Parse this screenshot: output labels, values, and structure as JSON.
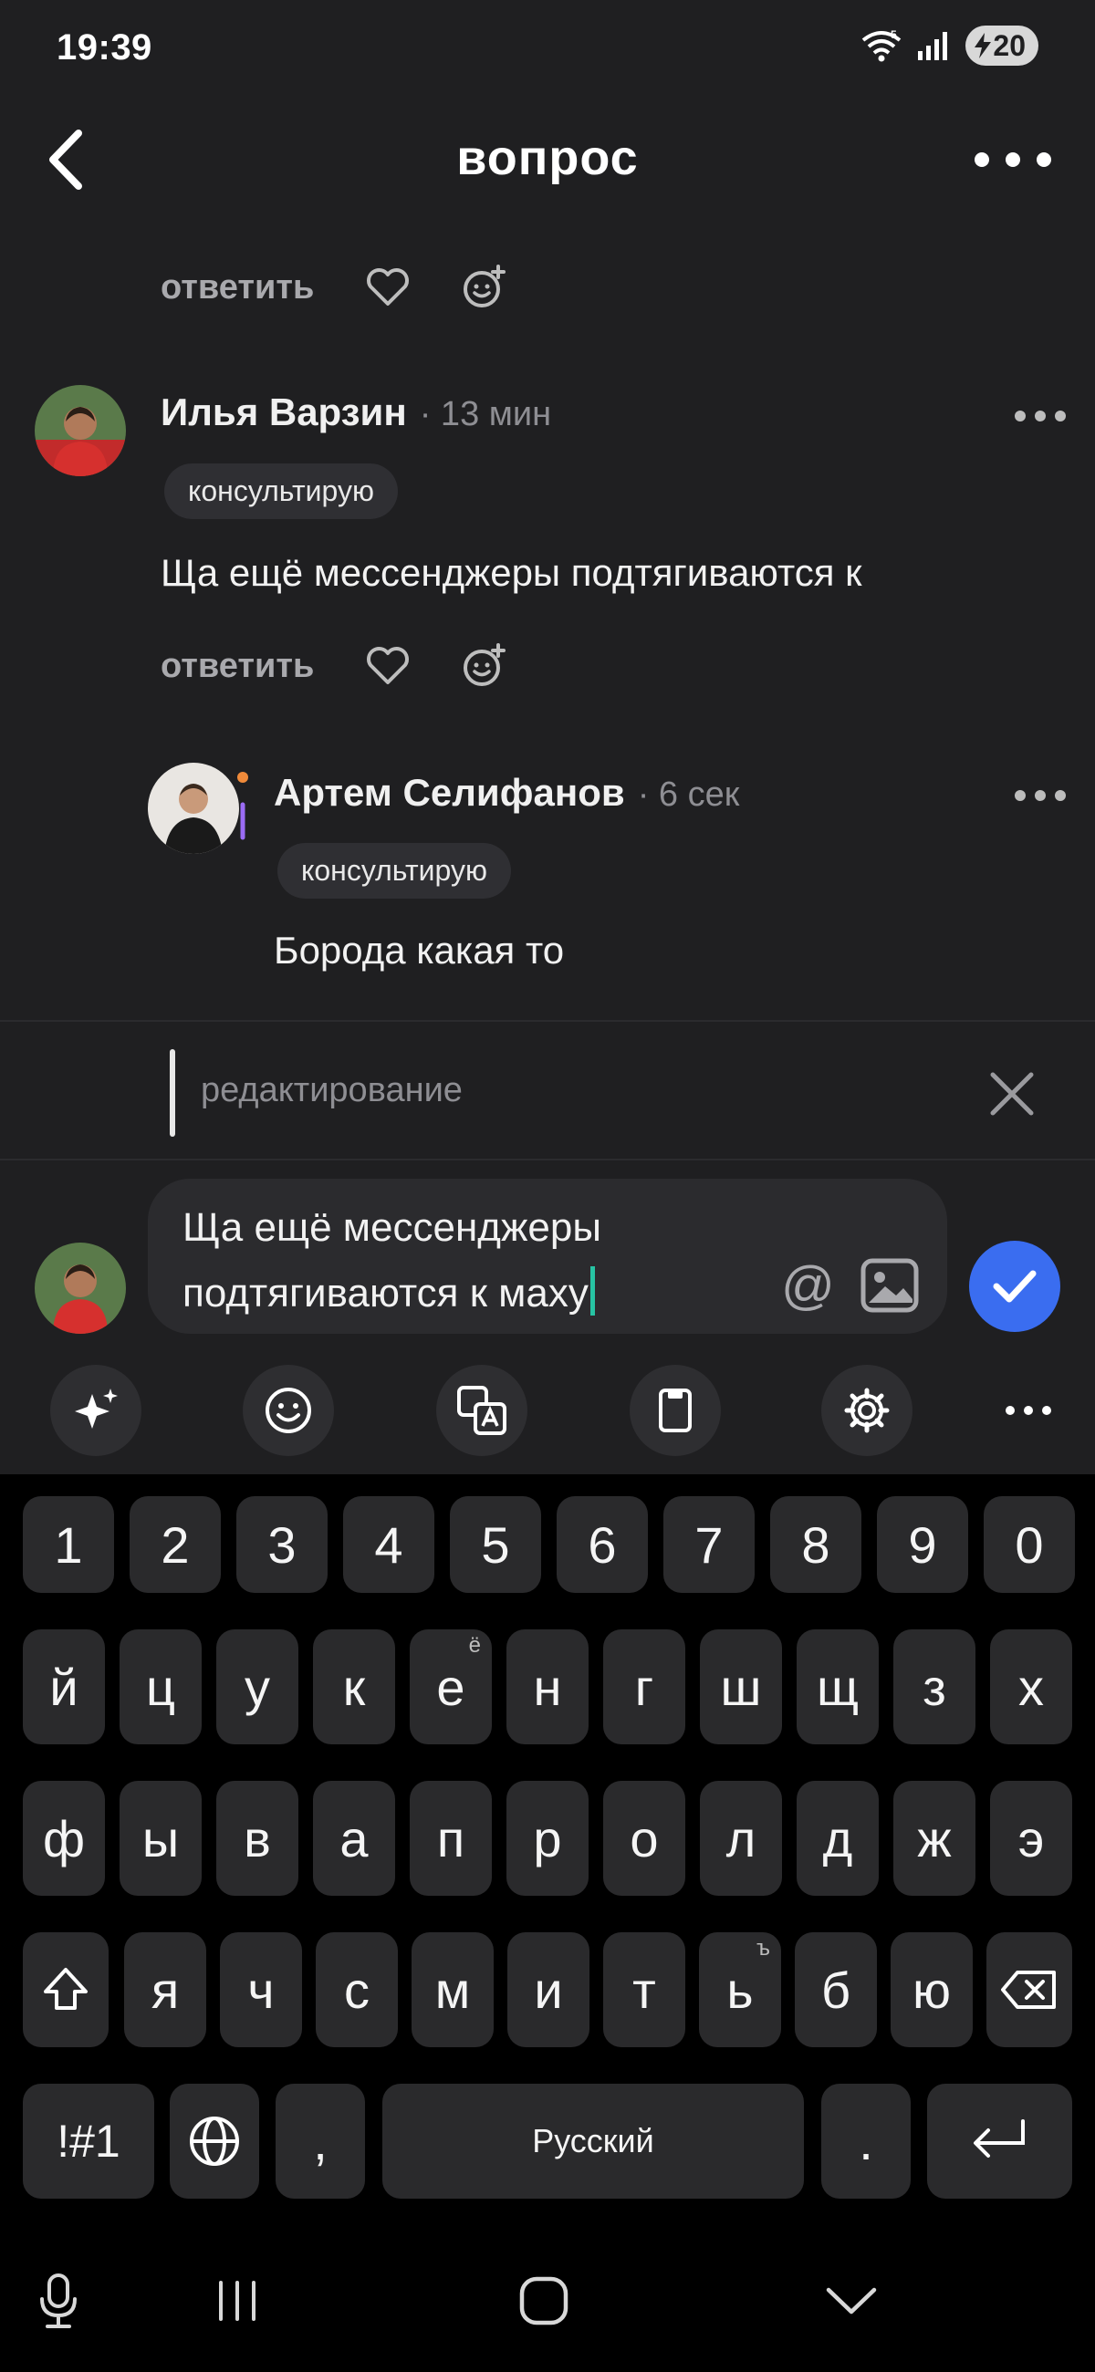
{
  "status_bar": {
    "time": "19:39",
    "battery": "20",
    "network": "5"
  },
  "header": {
    "title": "вопрос"
  },
  "comments": [
    {
      "reply_label": "ответить"
    },
    {
      "username": "Илья Варзин",
      "time": "· 13 мин",
      "badge": "консультирую",
      "text": "Ща ещё мессенджеры подтягиваются к",
      "reply_label": "ответить"
    },
    {
      "username": "Артем Селифанов",
      "time": "· 6 сек",
      "badge": "консультирую",
      "text": "Борода какая то"
    }
  ],
  "edit": {
    "label": "редактирование"
  },
  "input": {
    "value": "Ща ещё мессенджеры подтягиваются к маху",
    "at_symbol": "@"
  },
  "keyboard": {
    "row_numbers": [
      "1",
      "2",
      "3",
      "4",
      "5",
      "6",
      "7",
      "8",
      "9",
      "0"
    ],
    "row1": [
      "й",
      "ц",
      "у",
      "к",
      "е",
      "н",
      "г",
      "ш",
      "щ",
      "з",
      "х"
    ],
    "row2": [
      "ф",
      "ы",
      "в",
      "а",
      "п",
      "р",
      "о",
      "л",
      "д",
      "ж",
      "э"
    ],
    "row3": [
      "я",
      "ч",
      "с",
      "м",
      "и",
      "т",
      "ь",
      "б",
      "ю"
    ],
    "hint_e": "ё",
    "hint_soft": "ъ",
    "symbols_label": "!#1",
    "comma_label": ",",
    "space_label": "Русский",
    "period_label": "."
  },
  "colors": {
    "accent": "#3a6df0",
    "background": "#1f1f21",
    "caret": "#27c3a3"
  }
}
